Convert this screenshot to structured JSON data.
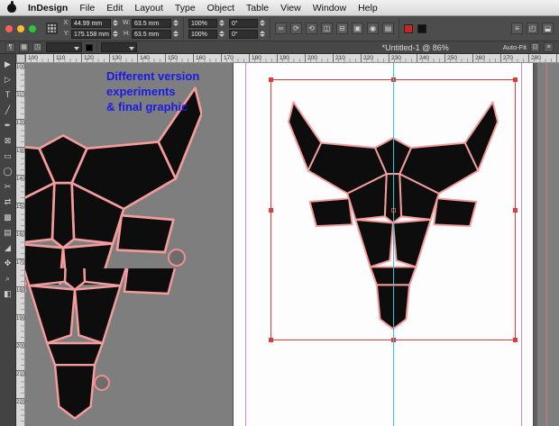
{
  "menu_bar": {
    "apple_icon": "apple-logo",
    "items": [
      "InDesign",
      "File",
      "Edit",
      "Layout",
      "Type",
      "Object",
      "Table",
      "View",
      "Window",
      "Help"
    ]
  },
  "window": {
    "doc_title": "*Untitled-1 @ 86%"
  },
  "control_panel": {
    "fields": {
      "x_label": "X:",
      "x_value": "44.99 mm",
      "y_label": "Y:",
      "y_value": "175.158 mm",
      "w_label": "W:",
      "w_value": "63.5 mm",
      "h_label": "H:",
      "h_value": "63.5 mm",
      "scale_x": "100%",
      "scale_y": "100%",
      "rotate": "0°",
      "shear": "0°"
    },
    "row1_icons": [
      {
        "name": "constrain-proportions-icon",
        "glyph": "∞"
      },
      {
        "name": "rotate-cw-icon",
        "glyph": "⟳"
      },
      {
        "name": "rotate-ccw-icon",
        "glyph": "⟲"
      },
      {
        "name": "flip-horizontal-icon",
        "glyph": "◫"
      },
      {
        "name": "flip-vertical-icon",
        "glyph": "⊟"
      },
      {
        "name": "select-container-icon",
        "glyph": "▣"
      },
      {
        "name": "select-content-icon",
        "glyph": "◉"
      },
      {
        "name": "effects-icon",
        "glyph": "▤"
      }
    ],
    "row1_end_icons": [
      {
        "name": "panel-options-icon",
        "glyph": "≡"
      },
      {
        "name": "workspace-icon",
        "glyph": "◰"
      },
      {
        "name": "screen-mode-icon",
        "glyph": "⬓"
      }
    ],
    "row2_icons": [
      {
        "name": "paragraph-icon",
        "glyph": "¶"
      },
      {
        "name": "grid-icon",
        "glyph": "▦"
      },
      {
        "name": "columns-icon",
        "glyph": "◳"
      }
    ],
    "auto_fit": "Auto-Fit",
    "swatches": {
      "fill": "#cc2222",
      "stroke": "#111111"
    }
  },
  "rulers": {
    "h_start": 100,
    "h_step": 10,
    "h_count": 19,
    "v_start": 100,
    "v_step": 10,
    "v_count": 13
  },
  "tools": [
    {
      "name": "selection-tool",
      "glyph": "▶"
    },
    {
      "name": "direct-selection-tool",
      "glyph": "▷"
    },
    {
      "name": "type-tool",
      "glyph": "T"
    },
    {
      "name": "line-tool",
      "glyph": "╱"
    },
    {
      "name": "pen-tool",
      "glyph": "✒"
    },
    {
      "name": "rectangle-frame-tool",
      "glyph": "⊠"
    },
    {
      "name": "rectangle-tool",
      "glyph": "▭"
    },
    {
      "name": "ellipse-tool",
      "glyph": "◯"
    },
    {
      "name": "scissors-tool",
      "glyph": "✂"
    },
    {
      "name": "free-transform-tool",
      "glyph": "⇄"
    },
    {
      "name": "gradient-tool",
      "glyph": "▩"
    },
    {
      "name": "note-tool",
      "glyph": "▤"
    },
    {
      "name": "eyedropper-tool",
      "glyph": "◢"
    },
    {
      "name": "hand-tool",
      "glyph": "✥"
    },
    {
      "name": "zoom-tool",
      "glyph": "⌕"
    },
    {
      "name": "fill-stroke-swatch",
      "glyph": "◧"
    }
  ],
  "annotation": {
    "lines": [
      "Different version",
      "experiments",
      "& final graphic"
    ],
    "color": "#1b1be8"
  },
  "colors": {
    "selection": "#dd3b3b",
    "bull_fill": "#0d0d0d",
    "bull_stroke": "#f59c9c",
    "guide_cyan": "#2ec7d8",
    "guide_margin": "#d786d7",
    "pasteboard": "#7e7e7e"
  }
}
